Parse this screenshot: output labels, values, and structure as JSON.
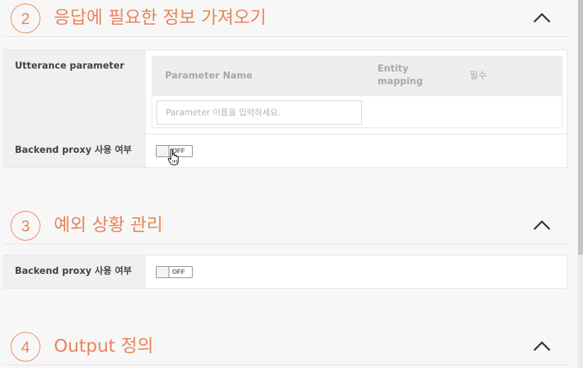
{
  "sections": [
    {
      "number": "2",
      "title": "응답에 필요한 정보 가져오기"
    },
    {
      "number": "3",
      "title": "예외 상황 관리"
    },
    {
      "number": "4",
      "title": "Output 정의"
    }
  ],
  "section2": {
    "utterance_label": "Utterance parameter",
    "table": {
      "columns": [
        "Parameter Name",
        "Entity mapping",
        "필수"
      ],
      "input_placeholder": "Parameter 이름을 입력하세요."
    },
    "backend_label": "Backend proxy 사용 여부",
    "toggle_state": "OFF"
  },
  "section3": {
    "backend_label": "Backend proxy 사용 여부",
    "toggle_state": "OFF"
  },
  "icons": {
    "collapse": "chevron-up-icon",
    "cursor": "hand-pointer-icon"
  },
  "colors": {
    "accent": "#e8845a",
    "label_bg": "#f0f0f0",
    "header_bg": "#eeeeee"
  }
}
